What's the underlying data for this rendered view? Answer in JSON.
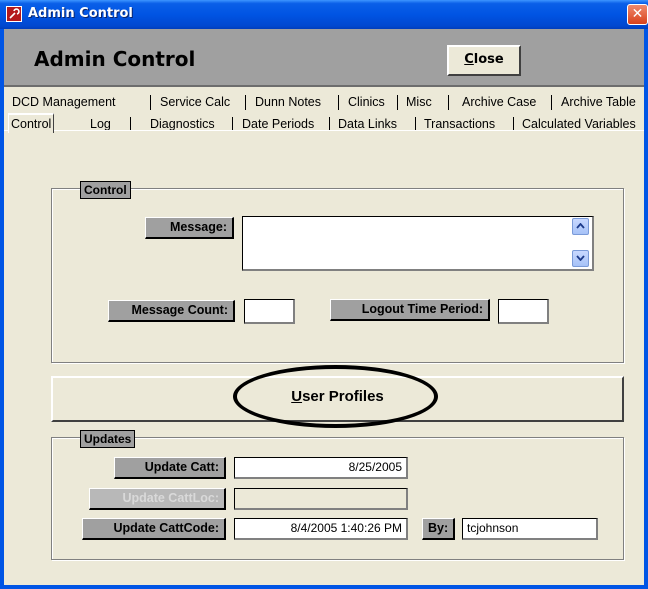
{
  "window": {
    "title": "Admin Control",
    "close_glyph": "✕",
    "app_icon": "access-key-icon"
  },
  "header": {
    "title": "Admin Control",
    "close_label_mnemonic": "C",
    "close_label_rest": "lose"
  },
  "tabs": {
    "row1": [
      "DCD Management",
      "Service Calc",
      "Dunn Notes",
      "Clinics",
      "Misc",
      "Archive Case",
      "Archive Table"
    ],
    "row2": [
      "Control",
      "Log",
      "Diagnostics",
      "Date Periods",
      "Data Links",
      "Transactions",
      "Calculated Variables"
    ],
    "active": "Control"
  },
  "control_group": {
    "label": "Control",
    "message_label": "Message:",
    "message_value": "",
    "message_count_label": "Message Count:",
    "message_count_value": "",
    "logout_label": "Logout Time Period:",
    "logout_value": ""
  },
  "user_profiles": {
    "mnemonic": "U",
    "rest": "ser Profiles"
  },
  "updates_group": {
    "label": "Updates",
    "update_catt_label": "Update Catt:",
    "update_catt_value": "8/25/2005",
    "update_cattloc_label": "Update CattLoc:",
    "update_cattloc_value": "",
    "update_cattcode_label": "Update CattCode:",
    "update_cattcode_value": "8/4/2005 1:40:26 PM",
    "by_label": "By:",
    "by_value": "tcjohnson"
  },
  "colors": {
    "titlebar": "#0054e3",
    "header_bg": "#a0a0a0",
    "panel_bg": "#ece9d8",
    "label_bg": "#a0a0a0"
  }
}
